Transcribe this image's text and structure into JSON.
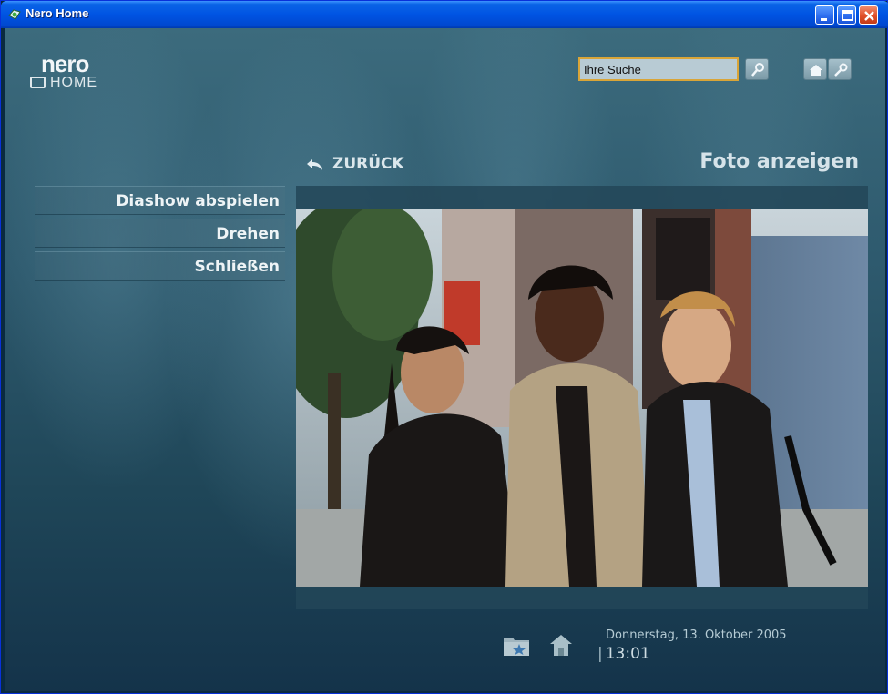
{
  "window": {
    "title": "Nero Home"
  },
  "search": {
    "value": "Ihre Suche"
  },
  "logo": {
    "brand": "nero",
    "sub": "HOME"
  },
  "header": {
    "back_label": "ZURÜCK",
    "view_title": "Foto anzeigen"
  },
  "menu": {
    "items": [
      {
        "label": "Diashow abspielen"
      },
      {
        "label": "Drehen"
      },
      {
        "label": "Schließen"
      }
    ]
  },
  "status": {
    "date": "Donnerstag, 13. Oktober 2005",
    "time": "13:01"
  },
  "icons": [
    "nero-app-icon",
    "minimize-icon",
    "maximize-icon",
    "close-icon",
    "search-icon",
    "home-icon",
    "settings-wrench-icon",
    "back-arrow-icon",
    "favorites-folder-icon",
    "home-icon"
  ],
  "colors": {
    "accent": "#d9a538",
    "titlebar": "#0054e3",
    "background": "#2e5a6e"
  }
}
